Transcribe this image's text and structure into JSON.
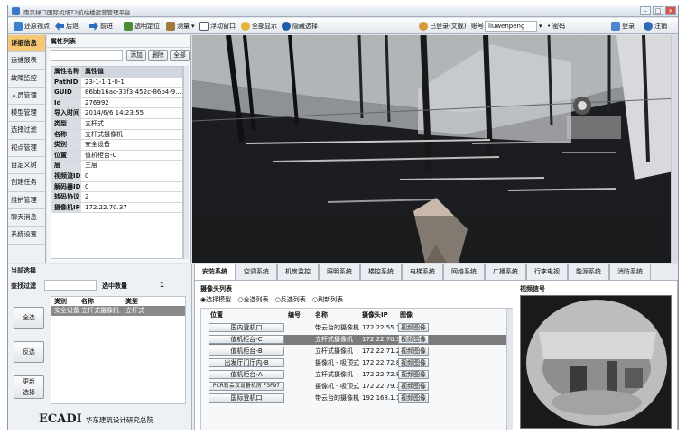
{
  "window": {
    "title": "南京禄口国际机场T2航站楼运营管理平台"
  },
  "toolbar": {
    "items": [
      {
        "label": "还原视点"
      },
      {
        "label": "后退"
      },
      {
        "label": "前进"
      },
      {
        "label": "透明定位"
      },
      {
        "label": "测量"
      },
      {
        "label": "浮动窗口"
      },
      {
        "label": "全部显示"
      },
      {
        "label": "隐藏选择"
      }
    ],
    "user_label": "已登录(文舰)",
    "account_label": "账号",
    "account_value": "liuwenpeng",
    "password_label": "密码",
    "login_label": "登录",
    "logout_label": "注销"
  },
  "sidebar": {
    "items": [
      {
        "label": "详细信息"
      },
      {
        "label": "运维报表"
      },
      {
        "label": "故障监控"
      },
      {
        "label": "人员管理"
      },
      {
        "label": "模型管理"
      },
      {
        "label": "选择过滤"
      },
      {
        "label": "视点管理"
      },
      {
        "label": "自定义树"
      },
      {
        "label": "创建任务"
      },
      {
        "label": "维护管理"
      },
      {
        "label": "聊天消息"
      },
      {
        "label": "系统设置"
      }
    ]
  },
  "attributes": {
    "title": "属性列表",
    "add_label": "添加",
    "delete_label": "删除",
    "all_label": "全部",
    "col_name": "属性名称",
    "col_value": "属性值",
    "rows": [
      {
        "k": "PathID",
        "v": "23-1-1-1-0-1"
      },
      {
        "k": "GUID",
        "v": "86bb16ac-33f3-452c-86b4-9..."
      },
      {
        "k": "Id",
        "v": "276992"
      },
      {
        "k": "导入时间",
        "v": "2014/6/6 14:23:55"
      },
      {
        "k": "类型",
        "v": "立杆式"
      },
      {
        "k": "名称",
        "v": "立杆式摄像机"
      },
      {
        "k": "类别",
        "v": "安全设备"
      },
      {
        "k": "位置",
        "v": "值机柜台-C"
      },
      {
        "k": "层",
        "v": "三层"
      },
      {
        "k": "视频流ID",
        "v": "0"
      },
      {
        "k": "解码器ID",
        "v": "0"
      },
      {
        "k": "转码协议",
        "v": "2"
      },
      {
        "k": "摄像机IP",
        "v": "172.22.70.37"
      }
    ]
  },
  "selection": {
    "title": "当前选择",
    "filter_label": "查找过滤",
    "count_label": "选中数量",
    "count_value": "1",
    "col_type": "类别",
    "col_name": "名称",
    "col_kind": "类型",
    "row": {
      "type": "安全设备",
      "name": "立杆式摄像机",
      "kind": "立杆式"
    },
    "select_all": "全选",
    "invert": "反选",
    "update": "更新\n选择",
    "logo": "ECADI",
    "org": "华东建筑设计研究总院"
  },
  "tabs": [
    {
      "label": "安防系统"
    },
    {
      "label": "空调系统"
    },
    {
      "label": "机房监控"
    },
    {
      "label": "照明系统"
    },
    {
      "label": "楼控系统"
    },
    {
      "label": "电梯系统"
    },
    {
      "label": "网络系统"
    },
    {
      "label": "广播系统"
    },
    {
      "label": "行李电视"
    },
    {
      "label": "能源系统"
    },
    {
      "label": "消防系统"
    }
  ],
  "cameras": {
    "list_title": "摄像头列表",
    "opt_model": "选择模型",
    "opt_all": "全选列表",
    "opt_invert": "反选列表",
    "opt_refresh": "刷新列表",
    "col_loc": "位置",
    "col_num": "编号",
    "col_name": "名称",
    "col_ip": "摄像头IP",
    "col_img": "图像",
    "view_label": "视频图像",
    "video_title": "视频信号",
    "rows": [
      {
        "loc": "国内登机口",
        "num": "",
        "name": "带云台的摄像机",
        "ip": "172.22.55.12"
      },
      {
        "loc": "值机柜台-C",
        "num": "",
        "name": "立杆式摄像机",
        "ip": "172.22.70.37"
      },
      {
        "loc": "值机柜台-B",
        "num": "",
        "name": "立杆式摄像机",
        "ip": "172.22.71.25"
      },
      {
        "loc": "出发厅门厅内-B",
        "num": "",
        "name": "摄像机 - 吸顶式",
        "ip": "172.22.72.82"
      },
      {
        "loc": "值机柜台-A",
        "num": "",
        "name": "立杆式摄像机",
        "ip": "172.22.72.84"
      },
      {
        "loc": "PCR新会议设备机房 F3F97",
        "num": "",
        "name": "摄像机 - 吸顶式",
        "ip": "172.22.79.11"
      },
      {
        "loc": "国际登机口",
        "num": "",
        "name": "带云台的摄像机",
        "ip": "192.168.1.1"
      }
    ]
  },
  "colors": {
    "active_tab": "#f7c873",
    "highlight": "#7b7b7b",
    "accent": "#2f6fbf"
  }
}
